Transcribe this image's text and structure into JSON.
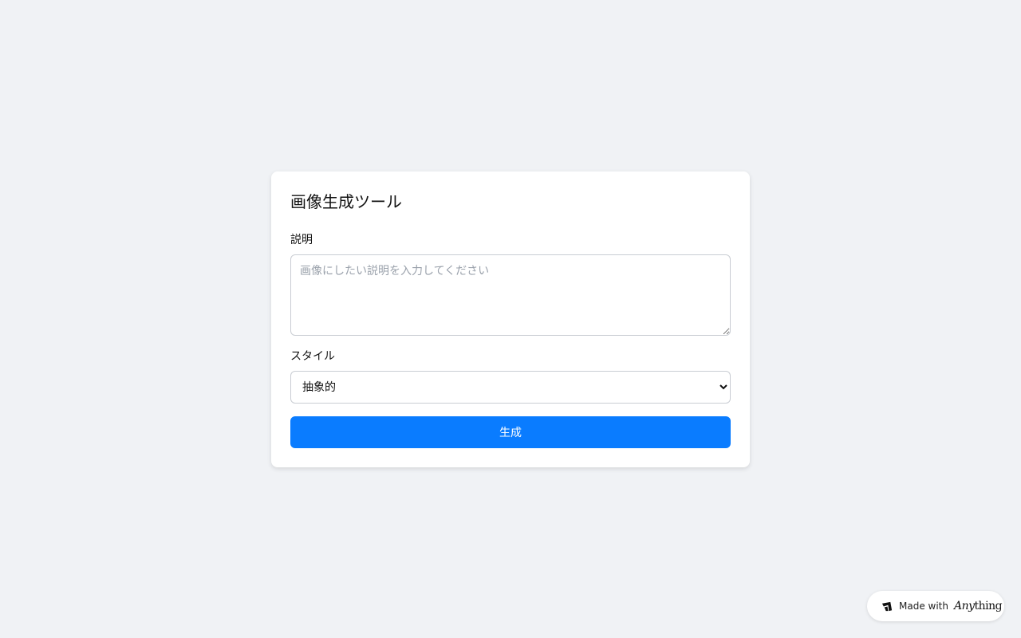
{
  "card": {
    "title": "画像生成ツール",
    "description": {
      "label": "説明",
      "placeholder": "画像にしたい説明を入力してください",
      "value": ""
    },
    "style": {
      "label": "スタイル",
      "selected": "抽象的"
    },
    "generate_button_label": "生成"
  },
  "badge": {
    "prefix": "Made with",
    "brand_italic": "Any",
    "brand_rest": "thing"
  },
  "colors": {
    "background": "#f0f2f5",
    "card": "#ffffff",
    "accent": "#0a7cff"
  }
}
